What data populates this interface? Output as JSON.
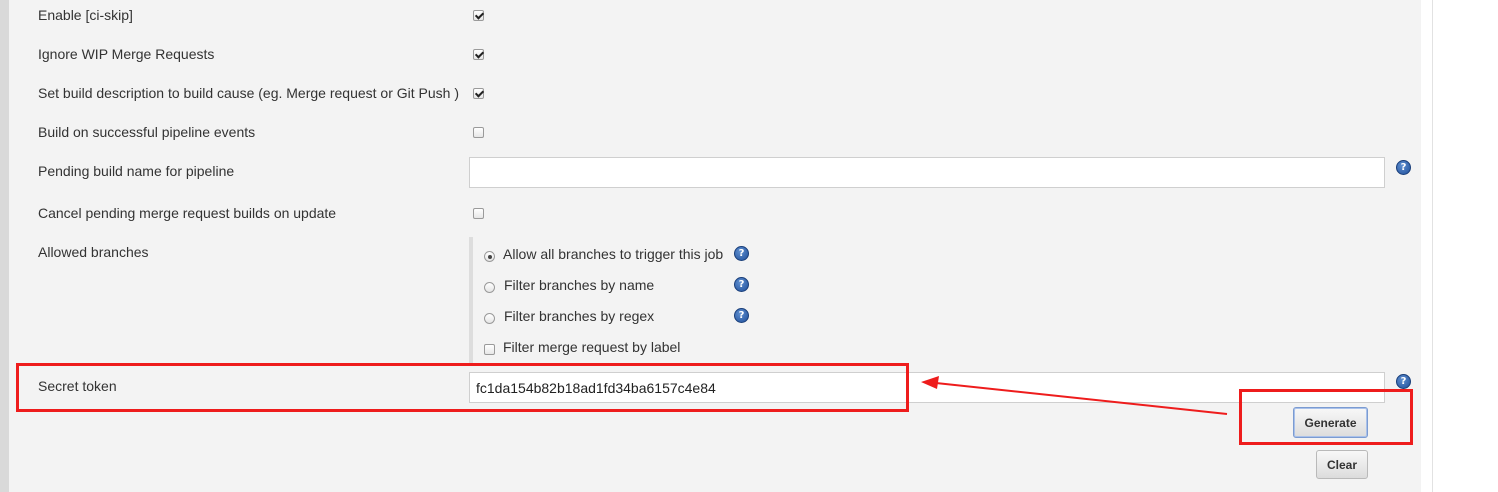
{
  "form": {
    "rows": [
      {
        "label": "Enable [ci-skip]",
        "checked": true
      },
      {
        "label": "Ignore WIP Merge Requests",
        "checked": true
      },
      {
        "label": "Set build description to build cause (eg. Merge request or Git Push )",
        "checked": true
      },
      {
        "label": "Build on successful pipeline events",
        "checked": false
      }
    ],
    "pending_build_name": {
      "label": "Pending build name for pipeline",
      "value": ""
    },
    "cancel_pending": {
      "label": "Cancel pending merge request builds on update",
      "checked": false
    },
    "allowed_branches": {
      "label": "Allowed branches",
      "options": [
        {
          "label": "Allow all branches to trigger this job",
          "selected": true
        },
        {
          "label": "Filter branches by name",
          "selected": false
        },
        {
          "label": "Filter branches by regex",
          "selected": false
        }
      ],
      "filter_by_label": {
        "label": "Filter merge request by label",
        "checked": false
      }
    },
    "secret_token": {
      "label": "Secret token",
      "value": "fc1da154b82b18ad1fd34ba6157c4e84"
    },
    "buttons": {
      "generate": "Generate",
      "clear": "Clear"
    }
  },
  "icons": {
    "help": "help-icon",
    "help_glyph": "?"
  },
  "colors": {
    "annotation": "#ee1c1c",
    "panel": "#f3f3f3",
    "help": "#2a5aa6"
  }
}
